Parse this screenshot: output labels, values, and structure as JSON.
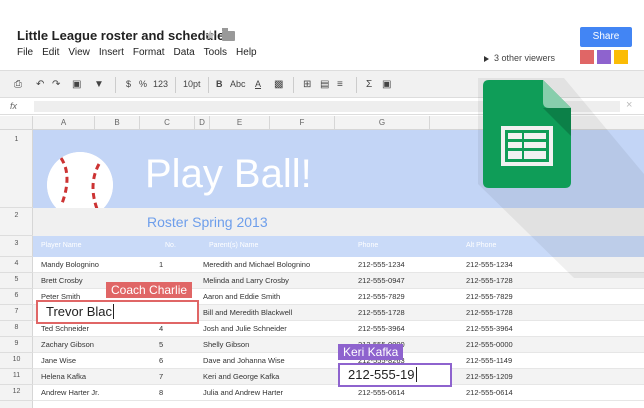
{
  "document": {
    "title": "Little League roster and schedule",
    "menu": [
      "File",
      "Edit",
      "View",
      "Insert",
      "Format",
      "Data",
      "Tools",
      "Help"
    ]
  },
  "share": {
    "label": "Share",
    "viewers_text": "3 other viewers",
    "viewer_colors": [
      "#e06666",
      "#8e63ce",
      "#f6b26b"
    ]
  },
  "toolbar": {
    "currency": "$",
    "percent": "%",
    "number_format": "123",
    "font_size": "10pt",
    "bold": "B",
    "font": "Abc",
    "text_color": "A",
    "sum": "Σ"
  },
  "formula_bar": {
    "fx": "fx",
    "close": "×"
  },
  "columns": [
    "A",
    "B",
    "C",
    "D",
    "E",
    "F",
    "G"
  ],
  "rows": [
    "1",
    "2",
    "3",
    "4",
    "5",
    "6",
    "7",
    "8",
    "9",
    "10",
    "11",
    "12"
  ],
  "sheet": {
    "hero_title": "Play Ball!",
    "subtitle": "Roster Spring 2013",
    "headers": {
      "player": "Player Name",
      "no": "No.",
      "parents": "Parent(s) Name",
      "phone": "Phone",
      "alt_phone": "Alt Phone"
    },
    "roster": [
      {
        "player": "Mandy Bolognino",
        "no": "1",
        "parents": "Meredith and Michael Bolognino",
        "phone": "212-555-1234",
        "alt": "212-555-1234"
      },
      {
        "player": "Brett Crosby",
        "no": "",
        "parents": "Melinda and Larry Crosby",
        "phone": "212-555-0947",
        "alt": "212-555-1728"
      },
      {
        "player": "Peter Smith",
        "no": "",
        "parents": "Aaron and Eddie Smith",
        "phone": "212-555-7829",
        "alt": "212-555-7829"
      },
      {
        "player": "",
        "no": "",
        "parents": "Bill and Meredith Blackwell",
        "phone": "212-555-1728",
        "alt": "212-555-1728"
      },
      {
        "player": "Ted Schneider",
        "no": "4",
        "parents": "Josh and Julie Schneider",
        "phone": "212-555-3964",
        "alt": "212-555-3964"
      },
      {
        "player": "Zachary Gibson",
        "no": "5",
        "parents": "Shelly Gibson",
        "phone": "212-555-0000",
        "alt": "212-555-0000"
      },
      {
        "player": "Jane Wise",
        "no": "6",
        "parents": "Dave and Johanna Wise",
        "phone": "212-555-8263",
        "alt": "212-555-1149"
      },
      {
        "player": "Helena Kafka",
        "no": "7",
        "parents": "Keri and George Kafka",
        "phone": "212-555-19",
        "alt": "212-555-1209"
      },
      {
        "player": "Andrew Harter Jr.",
        "no": "8",
        "parents": "Julia and Andrew Harter",
        "phone": "212-555-0614",
        "alt": "212-555-0614"
      }
    ]
  },
  "collaborators": {
    "coach": {
      "name": "Coach Charlie",
      "typing": "Trevor Blac",
      "color": "#e06666"
    },
    "keri": {
      "name": "Keri Kafka",
      "typing": "212-555-19",
      "color": "#8e63ce"
    }
  },
  "colors": {
    "hero": "#c3d5f6",
    "accent": "#4285f4",
    "sheets_green": "#0f9d58"
  },
  "icons": [
    "star-icon",
    "folder-icon",
    "print-icon",
    "undo-icon",
    "redo-icon",
    "paint-format-icon",
    "borders-icon",
    "merge-icon",
    "wrap-icon",
    "function-icon",
    "sheets-logo-icon"
  ]
}
